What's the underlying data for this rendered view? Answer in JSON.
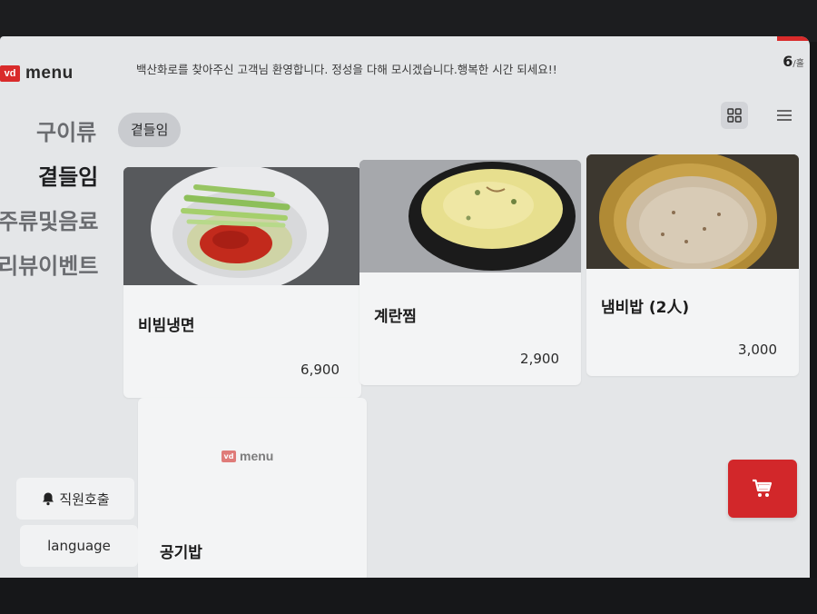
{
  "header": {
    "logo_badge": "vd",
    "logo_text": "menu",
    "welcome": "백산화로를 찾아주신 고객님 환영합니다. 정성을 다해 모시겠습니다.행복한 시간 되세요!!",
    "table_number": "6",
    "table_unit": "/홀"
  },
  "categories": [
    "구이류",
    "곁들임",
    "주류및음료",
    "리뷰이벤트"
  ],
  "active_category": "곁들임",
  "chip_label": "곁들임",
  "menu_items": [
    {
      "name": "비빔냉면",
      "price": "6,900"
    },
    {
      "name": "계란찜",
      "price": "2,900"
    },
    {
      "name": "냄비밥 (2人)",
      "price": "3,000"
    },
    {
      "name": "공기밥",
      "price": ""
    }
  ],
  "placeholder_logo": {
    "badge": "vd",
    "text": "menu"
  },
  "buttons": {
    "staff_call": "직원호출",
    "language": "language"
  },
  "icons": {
    "grid_view": "grid-view-icon",
    "list_view": "list-view-icon",
    "bell": "bell-icon",
    "cart": "cart-icon"
  },
  "colors": {
    "brand_red": "#d92b2b",
    "screen_bg": "#e4e6e8",
    "card_bg": "#f3f4f5"
  }
}
